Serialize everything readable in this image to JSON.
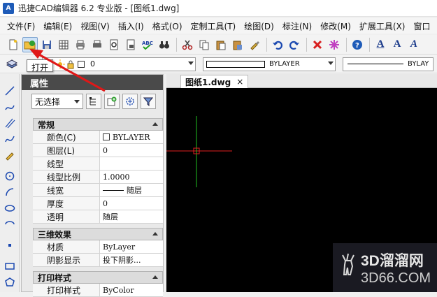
{
  "window": {
    "app_logo": "A",
    "title": "迅捷CAD编辑器 6.2 专业版 - [图纸1.dwg]"
  },
  "menu": [
    "文件(F)",
    "编辑(E)",
    "视图(V)",
    "插入(I)",
    "格式(O)",
    "定制工具(T)",
    "绘图(D)",
    "标注(N)",
    "修改(M)",
    "扩展工具(X)",
    "窗口"
  ],
  "toolbar": {
    "tooltip": "打开",
    "text_a_bold": "A",
    "text_a": "A",
    "text_ai": "A"
  },
  "layer_toolbar": {
    "layer_value": "0",
    "color_value": "BYLAYER",
    "linetype_value": "BYLAY"
  },
  "properties": {
    "header": "属性",
    "selection": "无选择",
    "sections": [
      {
        "title": "常规",
        "rows": [
          {
            "key": "颜色(C)",
            "value": "BYLAYER"
          },
          {
            "key": "图层(L)",
            "value": "0"
          },
          {
            "key": "线型",
            "value": ""
          },
          {
            "key": "线型比例",
            "value": "1.0000"
          },
          {
            "key": "线宽",
            "value": "随层"
          },
          {
            "key": "厚度",
            "value": "0"
          },
          {
            "key": "透明",
            "value": "随层"
          }
        ]
      },
      {
        "title": "三维效果",
        "rows": [
          {
            "key": "材质",
            "value": "ByLayer"
          },
          {
            "key": "阴影显示",
            "value": "投下阴影..."
          }
        ]
      },
      {
        "title": "打印样式",
        "rows": [
          {
            "key": "打印样式",
            "value": "ByColor"
          }
        ]
      }
    ]
  },
  "document": {
    "tab": "图纸1.dwg",
    "close": "×"
  },
  "watermark": {
    "main": "3D溜溜网",
    "sub": "3D66.COM"
  },
  "colors": {
    "canvas": "#000000",
    "crosshair_h": "#e02020",
    "crosshair_v": "#20c020",
    "arrow": "#e01818"
  }
}
